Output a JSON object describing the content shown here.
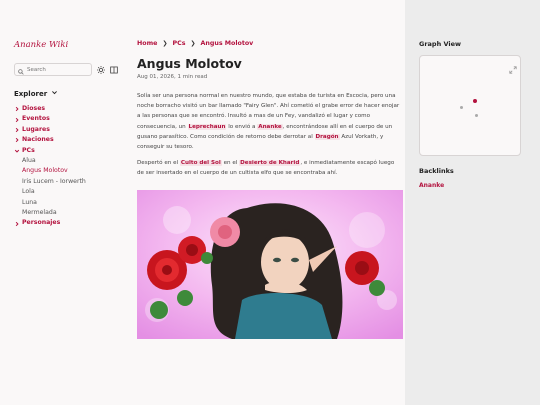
{
  "site": {
    "brand": "Ananke Wiki"
  },
  "search": {
    "placeholder": "Search"
  },
  "explorer": {
    "title": "Explorer",
    "folders": [
      {
        "label": "Dioses"
      },
      {
        "label": "Eventos"
      },
      {
        "label": "Lugares"
      },
      {
        "label": "Naciones"
      },
      {
        "label": "PCs",
        "open": true,
        "children": [
          "Alua",
          "Angus Molotov",
          "Iris Lucem - Iorwerth",
          "Lola",
          "Luna",
          "Mermelada"
        ],
        "active": "Angus Molotov"
      },
      {
        "label": "Personajes"
      }
    ]
  },
  "breadcrumb": [
    "Home",
    "PCs",
    "Angus Molotov"
  ],
  "page": {
    "title": "Angus Molotov",
    "meta": "Aug 01, 2026, 1 min read",
    "p1": {
      "t1": "Solía ser una persona normal en nuestro mundo, que estaba de turista en Escocia, pero una noche borracho visitó un bar llamado \"Fairy Glen\". Ahí cometió el grabe error de hacer enojar a las personas que se encontró. Insultó a mas de un Fey, vandalizó el lugar y como consecuencia, un ",
      "l1": "Leprechaun",
      "t2": " lo envió a ",
      "l2": "Ananke",
      "t3": ", encontrándose allí en el cuerpo de un gusano parasítico. Como condición de retorno debe derrotar al ",
      "l3": "Dragón",
      "t4": " Azul Vorkath, y conseguir su tesoro."
    },
    "p2": {
      "t1": "Despertó en el ",
      "l1": "Culto del Sol",
      "t2": " en el ",
      "l2": "Desierto de Kharid",
      "t3": ", e inmediatamente escapó luego de ser insertado en el cuerpo de un cultista elfo que se encontraba ahí."
    }
  },
  "graph": {
    "title": "Graph View"
  },
  "backlinks": {
    "title": "Backlinks",
    "items": [
      "Ananke"
    ]
  },
  "colors": {
    "accent": "#b3123e",
    "bg": "#faf8f8",
    "panel": "#ececec"
  }
}
